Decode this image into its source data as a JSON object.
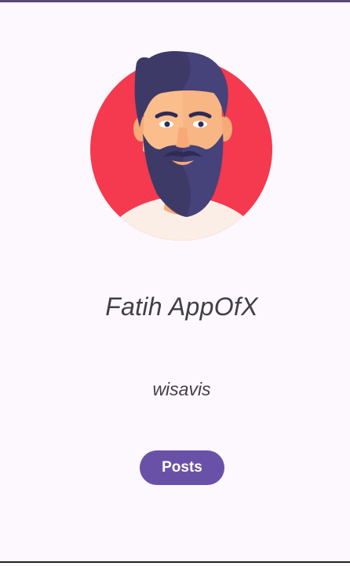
{
  "profile": {
    "name": "Fatih AppOfX",
    "username": "wisavis",
    "avatar_icon": "bearded-man-avatar"
  },
  "actions": {
    "posts_label": "Posts"
  },
  "colors": {
    "accent": "#6a51a8",
    "avatar_background": "#f5394f",
    "text": "#403e48",
    "surface": "#fdf8fd"
  }
}
